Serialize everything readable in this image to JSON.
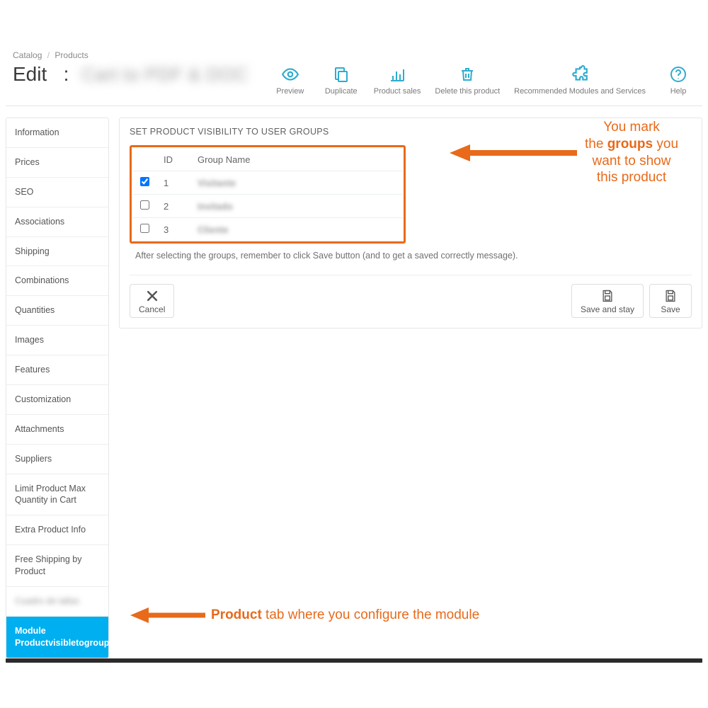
{
  "breadcrumb": {
    "root": "Catalog",
    "leaf": "Products"
  },
  "header": {
    "title_prefix": "Edit",
    "title_blur": "Cart to PDF & DOC"
  },
  "toolbar": {
    "preview": "Preview",
    "duplicate": "Duplicate",
    "sales": "Product sales",
    "delete": "Delete this product",
    "modules": "Recommended Modules and Services",
    "help": "Help"
  },
  "sidebar": {
    "items": [
      "Information",
      "Prices",
      "SEO",
      "Associations",
      "Shipping",
      "Combinations",
      "Quantities",
      "Images",
      "Features",
      "Customization",
      "Attachments",
      "Suppliers",
      "Limit Product Max Quantity in Cart",
      "Extra Product Info",
      "Free Shipping by Product",
      "Cuadro de tallas",
      "Module Productvisibletogroup"
    ]
  },
  "panel": {
    "title": "Set product visibility to user groups",
    "columns": {
      "id": "ID",
      "group": "Group Name"
    },
    "rows": [
      {
        "id": "1",
        "name": "Visitante",
        "checked": true
      },
      {
        "id": "2",
        "name": "Invitado",
        "checked": false
      },
      {
        "id": "3",
        "name": "Cliente",
        "checked": false
      }
    ],
    "hint": "After selecting the groups, remember to click Save button (and to get a saved correctly message)."
  },
  "actions": {
    "cancel": "Cancel",
    "save_stay": "Save and stay",
    "save": "Save"
  },
  "annotations": {
    "groups_line1": "You mark",
    "groups_line2a": "the ",
    "groups_bold": "groups",
    "groups_line2b": " you",
    "groups_line3": "want to show",
    "groups_line4": "this product",
    "tab_bold": "Product",
    "tab_rest": " tab where you configure the module"
  },
  "colors": {
    "accent": "#2eacce",
    "orange": "#e86a1a",
    "active_tab": "#00aff0"
  }
}
